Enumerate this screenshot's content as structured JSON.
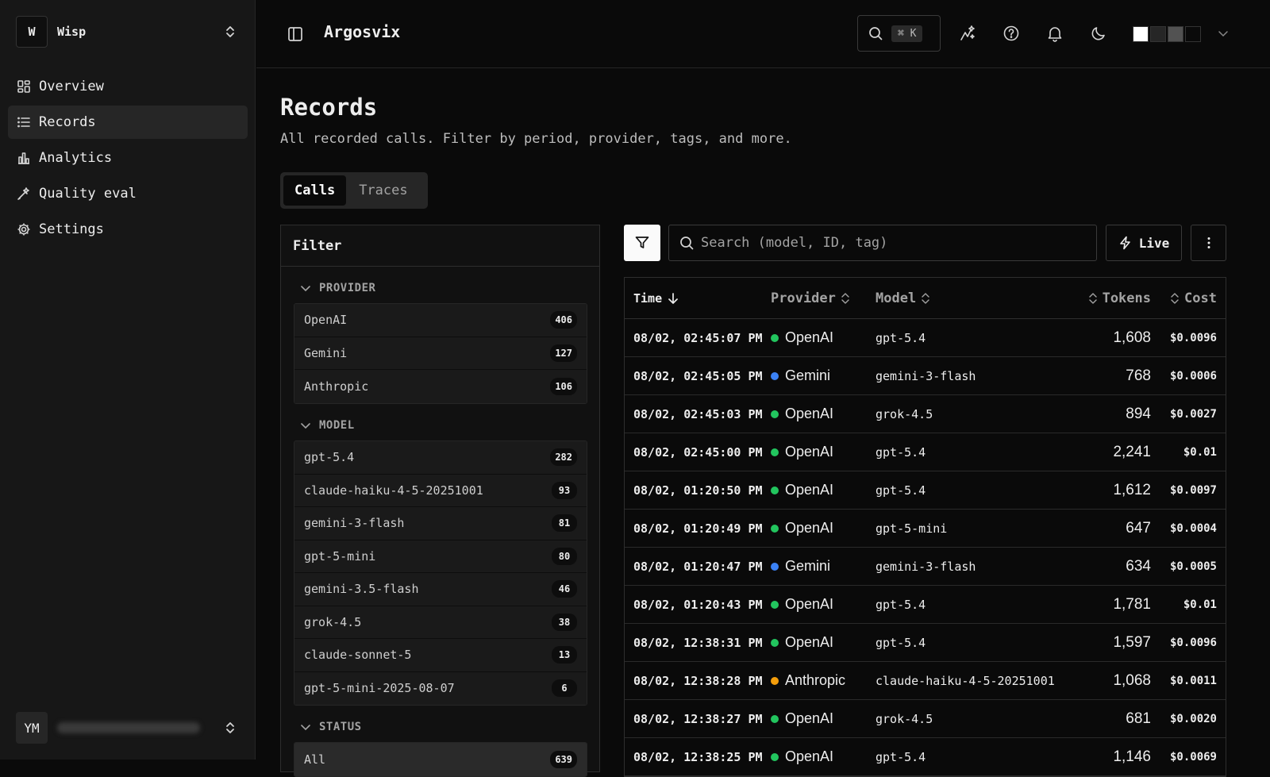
{
  "workspace": {
    "initial": "W",
    "name": "Wisp"
  },
  "sidebar": {
    "items": [
      {
        "label": "Overview",
        "icon": "dashboard-icon"
      },
      {
        "label": "Records",
        "icon": "list-icon",
        "active": true
      },
      {
        "label": "Analytics",
        "icon": "bar-chart-icon"
      },
      {
        "label": "Quality eval",
        "icon": "wand-icon"
      },
      {
        "label": "Settings",
        "icon": "gear-icon"
      }
    ]
  },
  "user": {
    "initials": "YM"
  },
  "header": {
    "title": "Argosvix",
    "shortcut": "⌘ K",
    "theme_swatches": [
      "#ffffff",
      "#262626",
      "#525252",
      "#0a0a0a"
    ]
  },
  "page": {
    "title": "Records",
    "subtitle": "All recorded calls. Filter by period, provider, tags, and more.",
    "tabs": [
      {
        "label": "Calls",
        "active": true
      },
      {
        "label": "Traces",
        "active": false
      }
    ]
  },
  "filter": {
    "title": "Filter",
    "sections": [
      {
        "label": "PROVIDER",
        "items": [
          {
            "label": "OpenAI",
            "count": "406"
          },
          {
            "label": "Gemini",
            "count": "127"
          },
          {
            "label": "Anthropic",
            "count": "106"
          }
        ]
      },
      {
        "label": "MODEL",
        "items": [
          {
            "label": "gpt-5.4",
            "count": "282"
          },
          {
            "label": "claude-haiku-4-5-20251001",
            "count": "93"
          },
          {
            "label": "gemini-3-flash",
            "count": "81"
          },
          {
            "label": "gpt-5-mini",
            "count": "80"
          },
          {
            "label": "gemini-3.5-flash",
            "count": "46"
          },
          {
            "label": "grok-4.5",
            "count": "38"
          },
          {
            "label": "claude-sonnet-5",
            "count": "13"
          },
          {
            "label": "gpt-5-mini-2025-08-07",
            "count": "6"
          }
        ]
      },
      {
        "label": "STATUS",
        "items": [
          {
            "label": "All",
            "count": "639"
          }
        ]
      }
    ]
  },
  "toolbar": {
    "search_placeholder": "Search (model, ID, tag)",
    "live_label": "Live"
  },
  "table": {
    "columns": {
      "time": "Time",
      "provider": "Provider",
      "model": "Model",
      "tokens": "Tokens",
      "cost": "Cost"
    },
    "provider_colors": {
      "OpenAI": "#22c55e",
      "Gemini": "#3b82f6",
      "Anthropic": "#f59e0b"
    },
    "rows": [
      {
        "time": "08/02, 02:45:07 PM",
        "provider": "OpenAI",
        "model": "gpt-5.4",
        "tokens": "1,608",
        "cost": "$0.0096"
      },
      {
        "time": "08/02, 02:45:05 PM",
        "provider": "Gemini",
        "model": "gemini-3-flash",
        "tokens": "768",
        "cost": "$0.0006"
      },
      {
        "time": "08/02, 02:45:03 PM",
        "provider": "OpenAI",
        "model": "grok-4.5",
        "tokens": "894",
        "cost": "$0.0027"
      },
      {
        "time": "08/02, 02:45:00 PM",
        "provider": "OpenAI",
        "model": "gpt-5.4",
        "tokens": "2,241",
        "cost": "$0.01"
      },
      {
        "time": "08/02, 01:20:50 PM",
        "provider": "OpenAI",
        "model": "gpt-5.4",
        "tokens": "1,612",
        "cost": "$0.0097"
      },
      {
        "time": "08/02, 01:20:49 PM",
        "provider": "OpenAI",
        "model": "gpt-5-mini",
        "tokens": "647",
        "cost": "$0.0004"
      },
      {
        "time": "08/02, 01:20:47 PM",
        "provider": "Gemini",
        "model": "gemini-3-flash",
        "tokens": "634",
        "cost": "$0.0005"
      },
      {
        "time": "08/02, 01:20:43 PM",
        "provider": "OpenAI",
        "model": "gpt-5.4",
        "tokens": "1,781",
        "cost": "$0.01"
      },
      {
        "time": "08/02, 12:38:31 PM",
        "provider": "OpenAI",
        "model": "gpt-5.4",
        "tokens": "1,597",
        "cost": "$0.0096"
      },
      {
        "time": "08/02, 12:38:28 PM",
        "provider": "Anthropic",
        "model": "claude-haiku-4-5-20251001",
        "tokens": "1,068",
        "cost": "$0.0011"
      },
      {
        "time": "08/02, 12:38:27 PM",
        "provider": "OpenAI",
        "model": "grok-4.5",
        "tokens": "681",
        "cost": "$0.0020"
      },
      {
        "time": "08/02, 12:38:25 PM",
        "provider": "OpenAI",
        "model": "gpt-5.4",
        "tokens": "1,146",
        "cost": "$0.0069"
      }
    ]
  }
}
